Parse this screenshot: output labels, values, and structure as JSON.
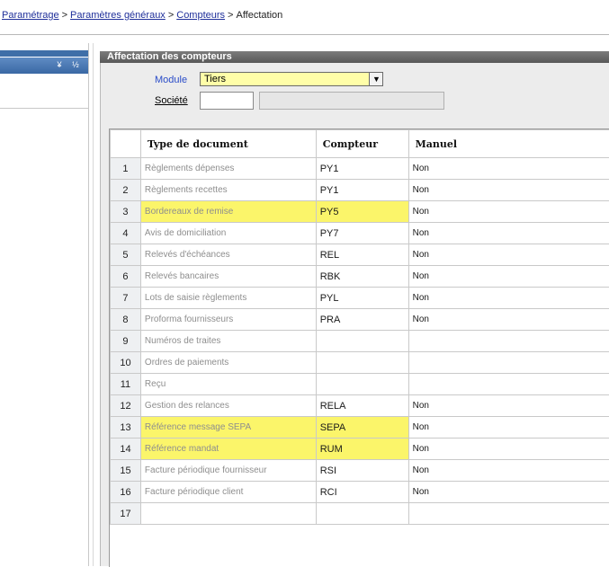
{
  "breadcrumb": {
    "items": [
      "Paramétrage",
      "Paramètres généraux",
      "Compteurs"
    ],
    "separator": ">",
    "current": "Affectation"
  },
  "leftpanel": {
    "btn_down": "¥",
    "btn_up": "½"
  },
  "group": {
    "title": "Affectation des compteurs",
    "module_label": "Module",
    "module_value": "Tiers",
    "societe_label": "Société",
    "societe_code": "",
    "societe_name": ""
  },
  "grid": {
    "columns": [
      "",
      "Type de document",
      "Compteur",
      "Manuel"
    ],
    "rows": [
      {
        "num": "1",
        "doc": "Règlements dépenses",
        "cpt": "PY1",
        "man": "Non",
        "hl": false
      },
      {
        "num": "2",
        "doc": "Règlements recettes",
        "cpt": "PY1",
        "man": "Non",
        "hl": false
      },
      {
        "num": "3",
        "doc": "Bordereaux de remise",
        "cpt": "PY5",
        "man": "Non",
        "hl": true
      },
      {
        "num": "4",
        "doc": "Avis de domiciliation",
        "cpt": "PY7",
        "man": "Non",
        "hl": false
      },
      {
        "num": "5",
        "doc": "Relevés d'échéances",
        "cpt": "REL",
        "man": "Non",
        "hl": false
      },
      {
        "num": "6",
        "doc": "Relevés bancaires",
        "cpt": "RBK",
        "man": "Non",
        "hl": false
      },
      {
        "num": "7",
        "doc": "Lots de saisie règlements",
        "cpt": "PYL",
        "man": "Non",
        "hl": false
      },
      {
        "num": "8",
        "doc": "Proforma fournisseurs",
        "cpt": "PRA",
        "man": "Non",
        "hl": false
      },
      {
        "num": "9",
        "doc": "Numéros de traites",
        "cpt": "",
        "man": "",
        "hl": false
      },
      {
        "num": "10",
        "doc": "Ordres de paiements",
        "cpt": "",
        "man": "",
        "hl": false
      },
      {
        "num": "11",
        "doc": "Reçu",
        "cpt": "",
        "man": "",
        "hl": false
      },
      {
        "num": "12",
        "doc": "Gestion des relances",
        "cpt": "RELA",
        "man": "Non",
        "hl": false
      },
      {
        "num": "13",
        "doc": "Référence message SEPA",
        "cpt": "SEPA",
        "man": "Non",
        "hl": true
      },
      {
        "num": "14",
        "doc": "Référence mandat",
        "cpt": "RUM",
        "man": "Non",
        "hl": true
      },
      {
        "num": "15",
        "doc": "Facture périodique fournisseur",
        "cpt": "RSI",
        "man": "Non",
        "hl": false
      },
      {
        "num": "16",
        "doc": "Facture périodique client",
        "cpt": "RCI",
        "man": "Non",
        "hl": false
      },
      {
        "num": "17",
        "doc": "",
        "cpt": "",
        "man": "",
        "hl": false
      }
    ]
  },
  "colors": {
    "highlight": "#fbf56a",
    "module_field": "#fffea8",
    "link": "#1f2f9a",
    "label_blue": "#2a4cc8"
  }
}
